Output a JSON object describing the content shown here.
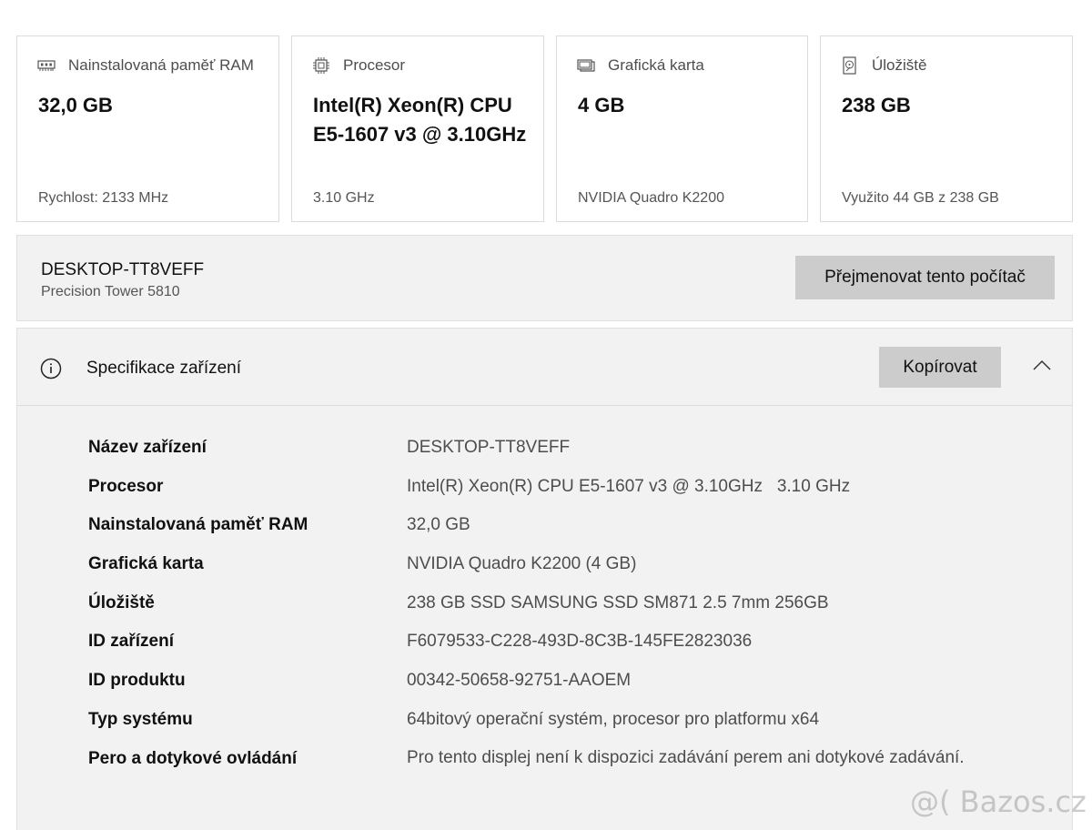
{
  "cards": [
    {
      "title": "Nainstalovaná paměť RAM",
      "value": "32,0 GB",
      "sub": "Rychlost: 2133 MHz",
      "icon": "ram-icon"
    },
    {
      "title": "Procesor",
      "value": "Intel(R) Xeon(R) CPU E5-1607 v3 @ 3.10GHz",
      "sub": "3.10 GHz",
      "icon": "cpu-icon"
    },
    {
      "title": "Grafická karta",
      "value": "4 GB",
      "sub": "NVIDIA Quadro K2200",
      "icon": "gpu-icon"
    },
    {
      "title": "Úložiště",
      "value": "238 GB",
      "sub": "Využito 44 GB z 238 GB",
      "icon": "storage-icon"
    }
  ],
  "device": {
    "name": "DESKTOP-TT8VEFF",
    "model": "Precision Tower 5810",
    "rename_label": "Přejmenovat tento počítač"
  },
  "spec": {
    "title": "Specifikace zařízení",
    "copy_label": "Kopírovat",
    "rows": [
      {
        "label": "Název zařízení",
        "value": "DESKTOP-TT8VEFF"
      },
      {
        "label": "Procesor",
        "value": "Intel(R) Xeon(R) CPU E5-1607 v3 @ 3.10GHz   3.10 GHz"
      },
      {
        "label": "Nainstalovaná paměť RAM",
        "value": "32,0 GB"
      },
      {
        "label": "Grafická karta",
        "value": "NVIDIA Quadro K2200 (4 GB)"
      },
      {
        "label": "Úložiště",
        "value": "238 GB SSD SAMSUNG SSD SM871 2.5 7mm 256GB"
      },
      {
        "label": "ID zařízení",
        "value": "F6079533-C228-493D-8C3B-145FE2823036"
      },
      {
        "label": "ID produktu",
        "value": "00342-50658-92751-AAOEM"
      },
      {
        "label": "Typ systému",
        "value": "64bitový operační systém, procesor pro platformu x64"
      },
      {
        "label": "Pero a dotykové ovládání",
        "value": "Pro tento displej není k dispozici zadávání perem ani dotykové zadávání."
      }
    ]
  },
  "watermark": "@( Bazos.cz"
}
